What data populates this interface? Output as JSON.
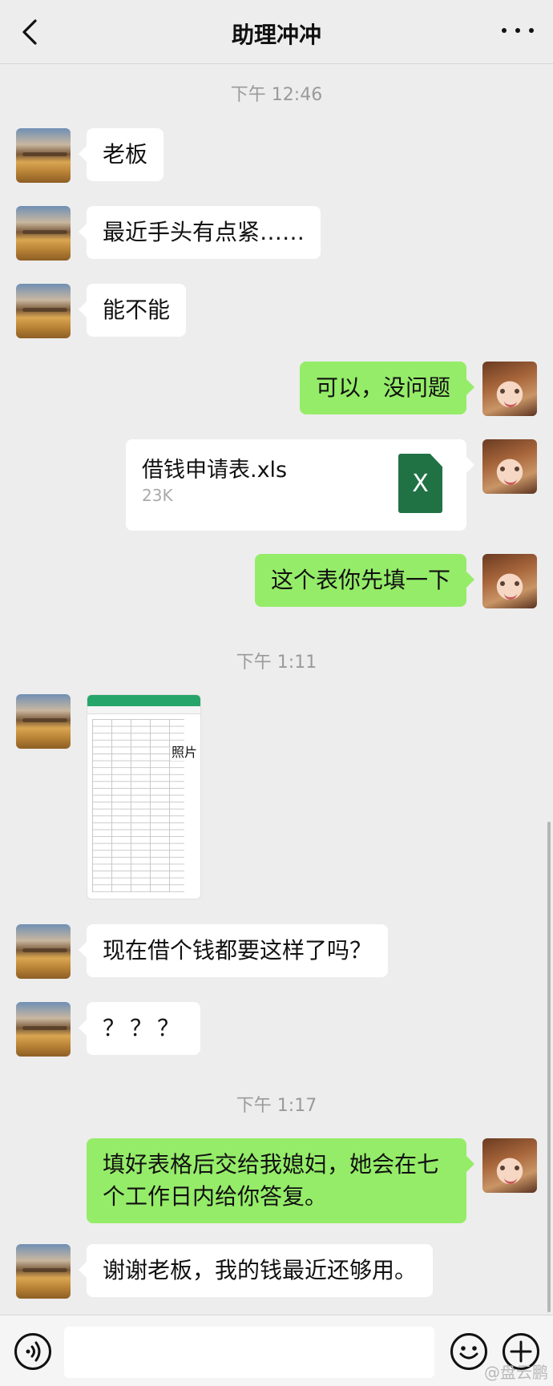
{
  "header": {
    "title": "助理冲冲"
  },
  "timestamps": [
    "下午 12:46",
    "下午 1:11",
    "下午 1:17"
  ],
  "messages": [
    {
      "side": "left",
      "text": "老板"
    },
    {
      "side": "left",
      "text": "最近手头有点紧……"
    },
    {
      "side": "left",
      "text": "能不能"
    },
    {
      "side": "right",
      "text": "可以，没问题"
    },
    {
      "side": "right",
      "type": "file",
      "file_name": "借钱申请表.xls",
      "file_size": "23K",
      "icon": "excel-file-icon",
      "icon_letter": "X"
    },
    {
      "side": "right",
      "text": "这个表你先填一下"
    },
    {
      "side": "left",
      "type": "image",
      "caption": "照片",
      "icon": "spreadsheet-screenshot"
    },
    {
      "side": "left",
      "text": "现在借个钱都要这样了吗？"
    },
    {
      "side": "left",
      "text": "？？？"
    },
    {
      "side": "right",
      "text": "填好表格后交给我媳妇，她会在七个工作日内给你答复。"
    },
    {
      "side": "left",
      "text": "谢谢老板，我的钱最近还够用。"
    }
  ],
  "watermark": "@盘云鹏",
  "colors": {
    "background": "#ededed",
    "bubble_left": "#ffffff",
    "bubble_right": "#95ec69",
    "excel": "#207245"
  }
}
